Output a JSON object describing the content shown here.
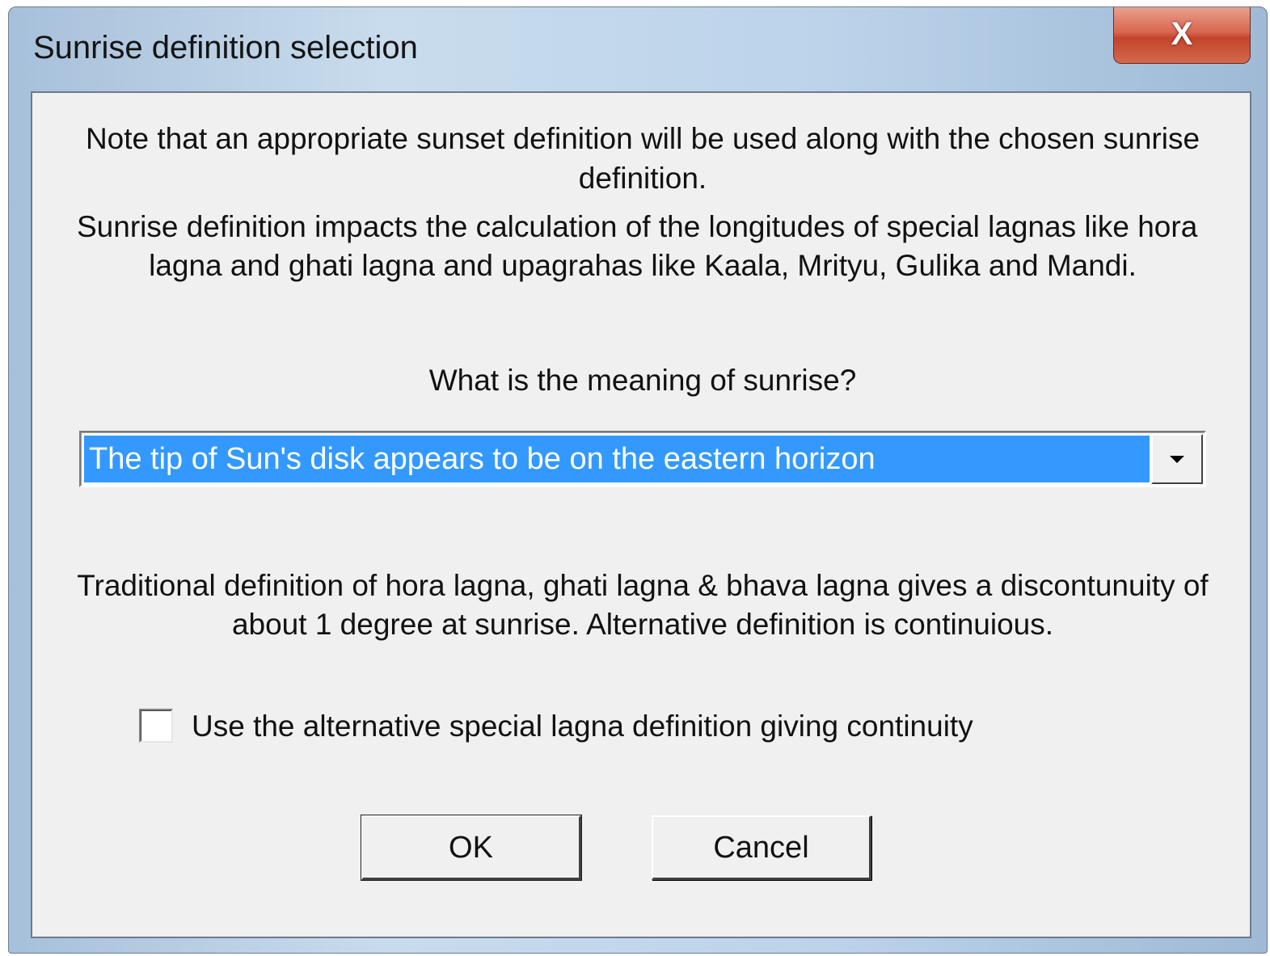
{
  "window": {
    "title": "Sunrise definition selection",
    "close_label": "X"
  },
  "content": {
    "note_line1": "Note that an appropriate sunset definition will be used along with the chosen sunrise",
    "note_line2": "definition.",
    "impact_line1": "Sunrise definition impacts the calculation of the longitudes of special lagnas like hora",
    "impact_line2": "lagna and ghati lagna and upagrahas like Kaala, Mrityu, Gulika and Mandi.",
    "question": "What is the meaning of sunrise?",
    "sunrise_select": {
      "selected": "The tip of Sun's disk appears to be on the eastern horizon",
      "icon": "chevron-down-icon"
    },
    "traditional_line1": "Traditional definition of hora lagna, ghati lagna & bhava lagna gives a discontunuity of",
    "traditional_line2": "about 1 degree at sunrise. Alternative definition is continuious.",
    "checkbox": {
      "label": "Use the alternative special lagna definition giving continuity",
      "checked": false
    }
  },
  "buttons": {
    "ok": "OK",
    "cancel": "Cancel"
  },
  "colors": {
    "selection_highlight": "#3399ff",
    "dialog_background": "#f0f0f0",
    "close_button": "#c9452c"
  }
}
